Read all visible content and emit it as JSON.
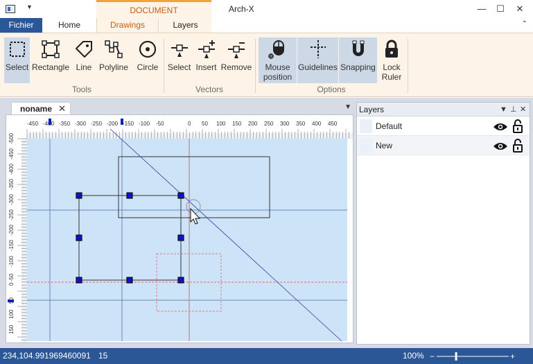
{
  "titlebar": {
    "app_title": "Arch-X",
    "context_tab_header": "DOCUMENT",
    "quick_access_dropdown": "▼",
    "minimize": "—",
    "restore": "☐",
    "close": "✕"
  },
  "tabs": {
    "fichier": "Fichier",
    "home": "Home",
    "drawings": "Drawings",
    "layers": "Layers",
    "collapse": "⌃"
  },
  "ribbon": {
    "groups": {
      "tools": "Tools",
      "vectors": "Vectors",
      "options": "Options"
    },
    "buttons": {
      "select": "Select",
      "rectangle": "Rectangle",
      "line": "Line",
      "polyline": "Polyline",
      "circle": "Circle",
      "vector_select": "Select",
      "insert": "Insert",
      "remove": "Remove",
      "mouse_position_1": "Mouse",
      "mouse_position_2": "position",
      "guidelines": "Guidelines",
      "snapping": "Snapping",
      "lock_ruler_1": "Lock",
      "lock_ruler_2": "Ruler"
    }
  },
  "document": {
    "tab_name": "noname",
    "tab_close": "✕",
    "menu": "▼",
    "ruler_h_ticks": [
      "-450",
      "-400",
      "-350",
      "-300",
      "-250",
      "-200",
      "-150",
      "-100",
      "-50",
      "0",
      "50",
      "100",
      "150",
      "200",
      "250",
      "300",
      "350",
      "400",
      "450"
    ],
    "ruler_v_ticks": [
      "-500",
      "-450",
      "-400",
      "-350",
      "-300",
      "-250",
      "-200",
      "-150",
      "-100",
      "-50",
      "0",
      "50",
      "100",
      "150"
    ]
  },
  "layers_panel": {
    "title": "Layers",
    "header_dropdown": "▼",
    "header_pin": "⊥",
    "header_close": "✕",
    "layers": [
      {
        "name": "Default"
      },
      {
        "name": "New"
      }
    ]
  },
  "statusbar": {
    "coords": "234,104.991969460091",
    "count": "15",
    "zoom": "100%",
    "zoom_minus": "−",
    "zoom_plus": "+",
    "zoom_level": 0.27
  },
  "colors": {
    "accent": "#2b5797",
    "ribbon_bg": "#fdf3e6",
    "context_orange": "#f0a33c",
    "canvas_bg": "#cde3f7",
    "handle_fill": "#1010d0",
    "selection_red": "#e47b84"
  }
}
